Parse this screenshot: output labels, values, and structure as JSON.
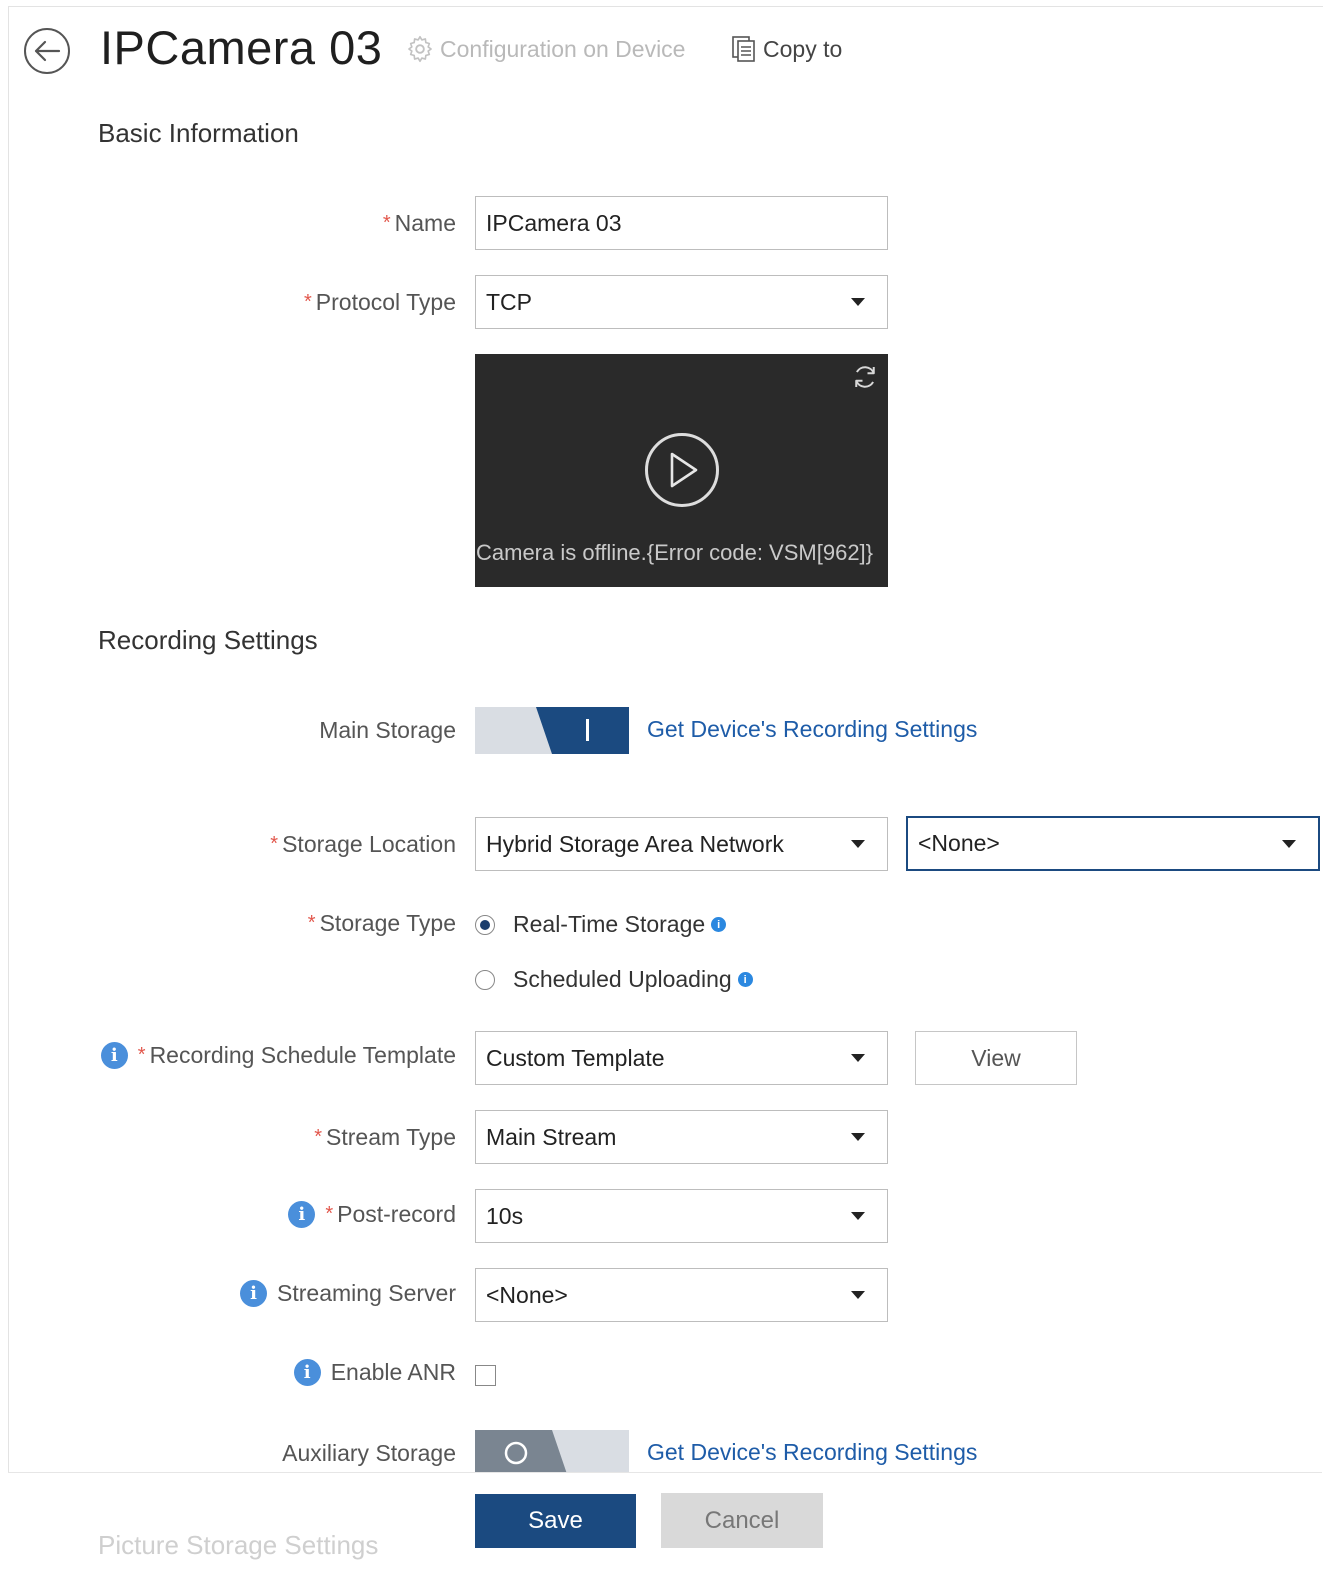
{
  "header": {
    "title": "IPCamera 03",
    "config_link": "Configuration on Device",
    "copy_link": "Copy to"
  },
  "basic": {
    "section_title": "Basic Information",
    "name_label": "Name",
    "name_value": "IPCamera 03",
    "protocol_label": "Protocol Type",
    "protocol_value": "TCP",
    "preview_message": "Camera is offline.{Error code: VSM[962]}"
  },
  "recording": {
    "section_title": "Recording Settings",
    "main_storage_label": "Main Storage",
    "main_storage_enabled": true,
    "get_settings_link": "Get Device's Recording Settings",
    "storage_location_label": "Storage Location",
    "storage_location_value": "Hybrid Storage Area Network",
    "storage_location_sub_value": "<None>",
    "storage_type_label": "Storage Type",
    "storage_type_options": [
      "Real-Time Storage",
      "Scheduled Uploading"
    ],
    "storage_type_selected": "Real-Time Storage",
    "schedule_label": "Recording Schedule Template",
    "schedule_value": "Custom Template",
    "view_button": "View",
    "stream_label": "Stream Type",
    "stream_value": "Main Stream",
    "postrecord_label": "Post-record",
    "postrecord_value": "10s",
    "streaming_label": "Streaming Server",
    "streaming_value": "<None>",
    "anr_label": "Enable ANR",
    "anr_checked": false,
    "aux_storage_label": "Auxiliary Storage",
    "aux_storage_enabled": false,
    "aux_get_settings_link": "Get Device's Recording Settings"
  },
  "picture": {
    "section_title": "Picture Storage Settings"
  },
  "footer": {
    "save_label": "Save",
    "cancel_label": "Cancel"
  },
  "colors": {
    "primary": "#1b4a80",
    "link": "#1e5ca8",
    "required": "#e2574c",
    "info": "#4a8fdb"
  },
  "required_marker": "*"
}
